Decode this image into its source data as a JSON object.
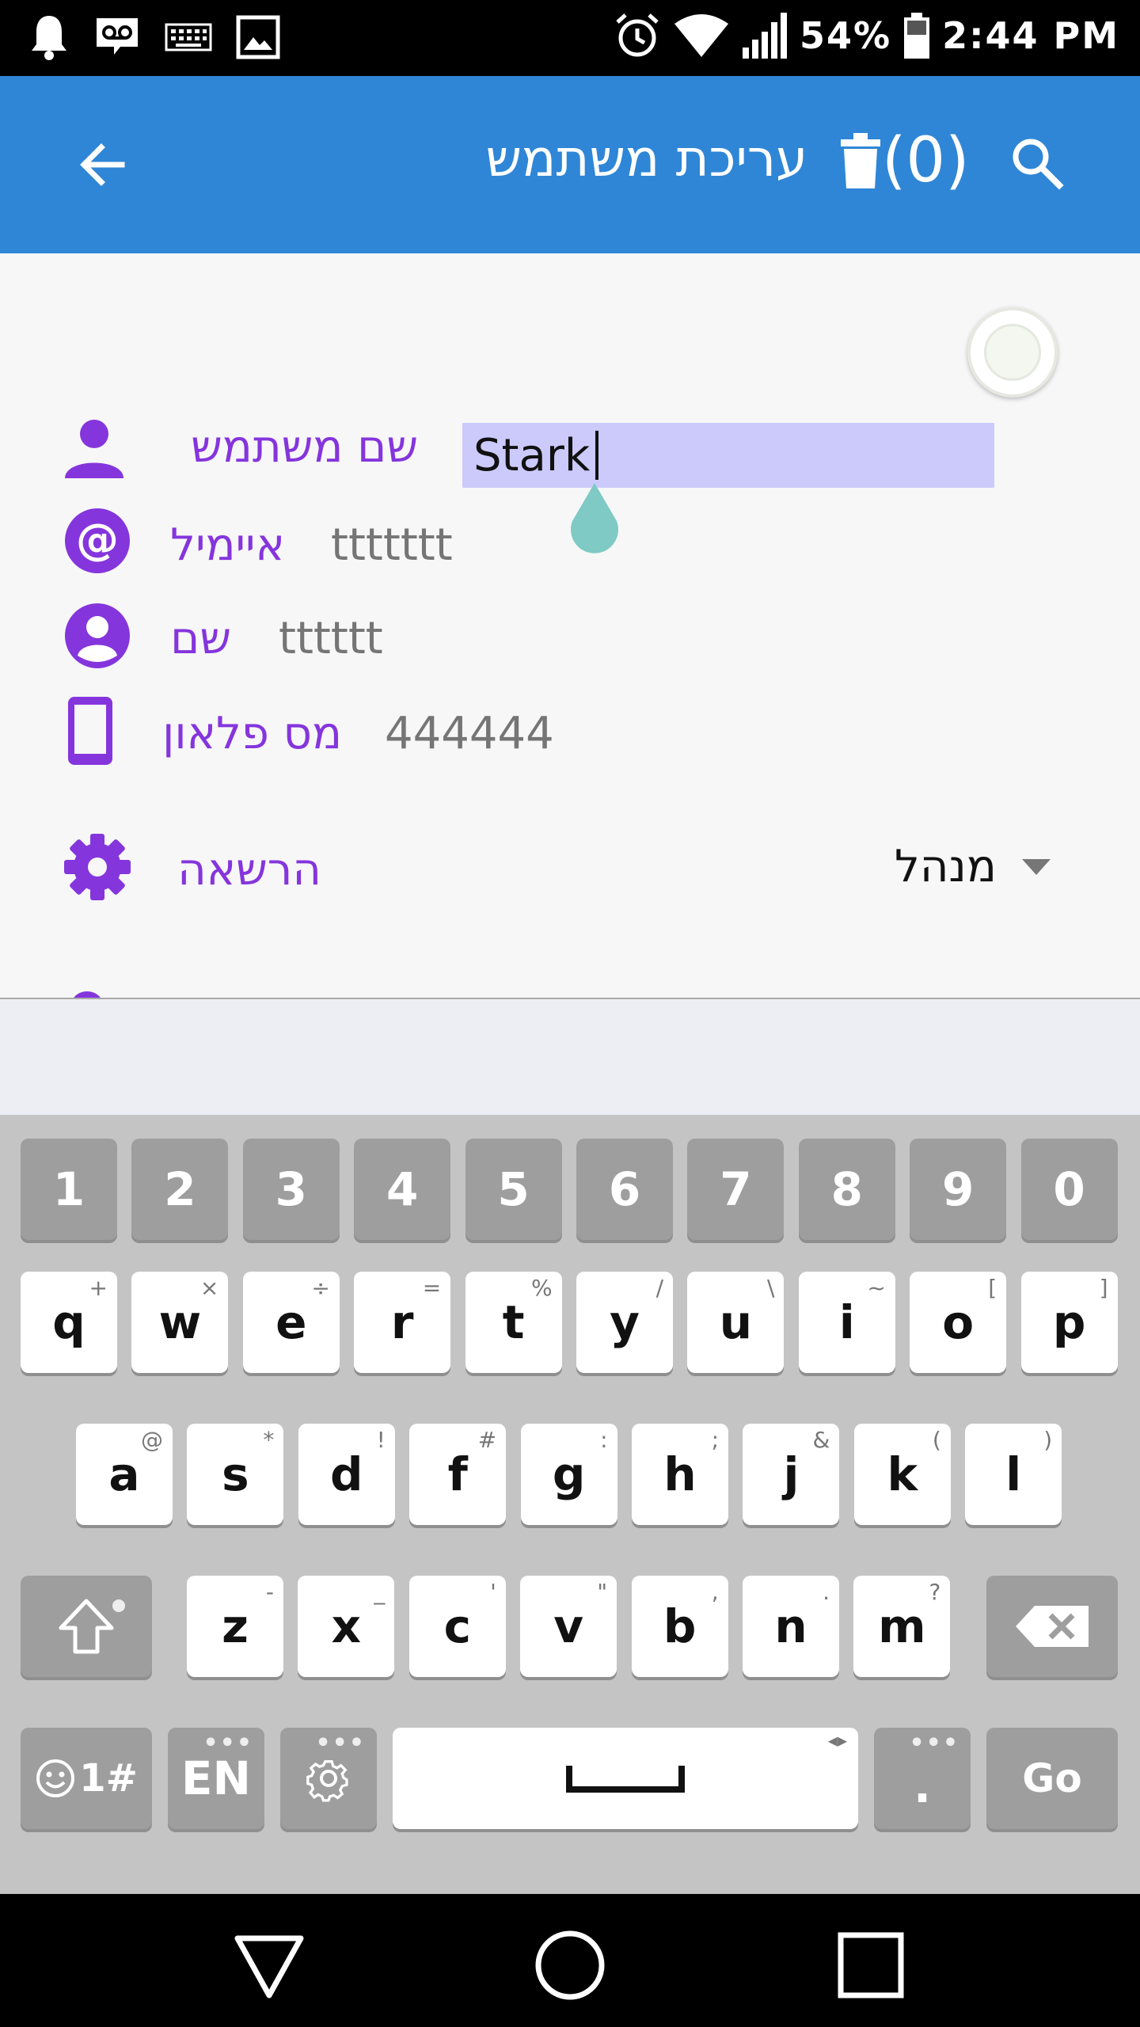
{
  "status_bar": {
    "battery": "54%",
    "time": "2:44 PM",
    "icons": [
      "notification-bell-icon",
      "voicemail-icon",
      "keyboard-icon",
      "image-icon",
      "alarm-icon",
      "wifi-icon",
      "signal-icon",
      "battery-icon"
    ]
  },
  "app_bar": {
    "title": "עריכת משתמש",
    "trash_count": "(0)",
    "icons": [
      "back-arrow-icon",
      "trash-icon",
      "search-icon"
    ]
  },
  "form": {
    "username": {
      "label": "שם משתמש",
      "value": "Stark"
    },
    "email": {
      "label": "איימיל",
      "value": "ttttttt"
    },
    "name": {
      "label": "שם",
      "value": "tttttt"
    },
    "phone": {
      "label": "מס פלאון",
      "value": "444444"
    },
    "permission": {
      "label": "הרשאה",
      "selected": "מנהל"
    }
  },
  "keyboard": {
    "number_row": [
      "1",
      "2",
      "3",
      "4",
      "5",
      "6",
      "7",
      "8",
      "9",
      "0"
    ],
    "row1": [
      {
        "k": "q",
        "h": "+"
      },
      {
        "k": "w",
        "h": "×"
      },
      {
        "k": "e",
        "h": "÷"
      },
      {
        "k": "r",
        "h": "="
      },
      {
        "k": "t",
        "h": "%"
      },
      {
        "k": "y",
        "h": "/"
      },
      {
        "k": "u",
        "h": "\\"
      },
      {
        "k": "i",
        "h": "~"
      },
      {
        "k": "o",
        "h": "["
      },
      {
        "k": "p",
        "h": "]"
      }
    ],
    "row2": [
      {
        "k": "a",
        "h": "@"
      },
      {
        "k": "s",
        "h": "*"
      },
      {
        "k": "d",
        "h": "!"
      },
      {
        "k": "f",
        "h": "#"
      },
      {
        "k": "g",
        "h": ":"
      },
      {
        "k": "h",
        "h": ";"
      },
      {
        "k": "j",
        "h": "&"
      },
      {
        "k": "k",
        "h": "("
      },
      {
        "k": "l",
        "h": ")"
      }
    ],
    "row3": [
      {
        "k": "z",
        "h": "-"
      },
      {
        "k": "x",
        "h": "_"
      },
      {
        "k": "c",
        "h": "'"
      },
      {
        "k": "v",
        "h": "\""
      },
      {
        "k": "b",
        "h": ","
      },
      {
        "k": "n",
        "h": "."
      },
      {
        "k": "m",
        "h": "?"
      }
    ],
    "symbols_key": "1#",
    "language_key": "EN",
    "period_key": ".",
    "go_key": "Go"
  },
  "nav_bar": {
    "icons": [
      "back-triangle-icon",
      "home-circle-icon",
      "recents-square-icon"
    ]
  }
}
